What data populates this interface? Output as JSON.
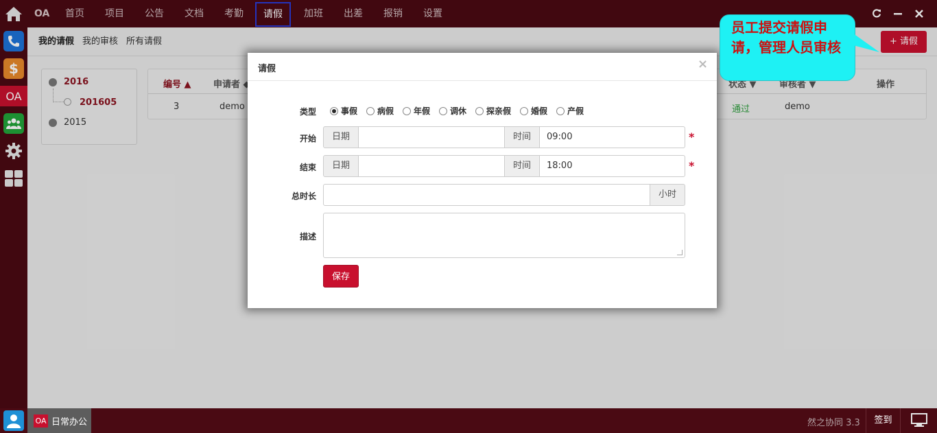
{
  "topbar": {
    "logo": "OA",
    "nav": [
      "首页",
      "项目",
      "公告",
      "文档",
      "考勤",
      "请假",
      "加班",
      "出差",
      "报销",
      "设置"
    ],
    "active": "请假"
  },
  "sidebar": {
    "icons": [
      "home-icon",
      "phone-icon",
      "dollar-icon",
      "oa-icon",
      "group-icon",
      "gear-icon",
      "grid-icon"
    ],
    "oa_label": "OA",
    "dollar_label": "$"
  },
  "subnav": {
    "tabs": [
      "我的请假",
      "我的审核",
      "所有请假"
    ],
    "new_button": "+ 请假"
  },
  "tree": {
    "year1": "2016",
    "month1": "201605",
    "year2": "2015"
  },
  "table": {
    "headers": [
      "编号 ▲",
      "申请者 ◆",
      "状态 ▼",
      "审核者 ▼",
      "操作"
    ],
    "row": {
      "id": "3",
      "applicant": "demo",
      "status": "通过",
      "reviewer": "demo"
    }
  },
  "modal": {
    "title": "请假",
    "close": "×",
    "type_label": "类型",
    "types": [
      "事假",
      "病假",
      "年假",
      "调休",
      "探亲假",
      "婚假",
      "产假"
    ],
    "selected_type": "事假",
    "start_label": "开始",
    "end_label": "结束",
    "date_addon": "日期",
    "time_addon": "时间",
    "start_time": "09:00",
    "end_time": "18:00",
    "required": "*",
    "duration_label": "总时长",
    "duration_unit": "小时",
    "desc_label": "描述",
    "save": "保存"
  },
  "callout": {
    "text": "员工提交请假申请，管理人员审核"
  },
  "bottombar": {
    "task_badge": "OA",
    "task_label": "日常办公",
    "brand": "然之协同 3.3",
    "signin": "签到"
  },
  "colors": {
    "bar": "#4a0a13",
    "accent": "#c8102e",
    "callout": "#1ef1f4"
  }
}
